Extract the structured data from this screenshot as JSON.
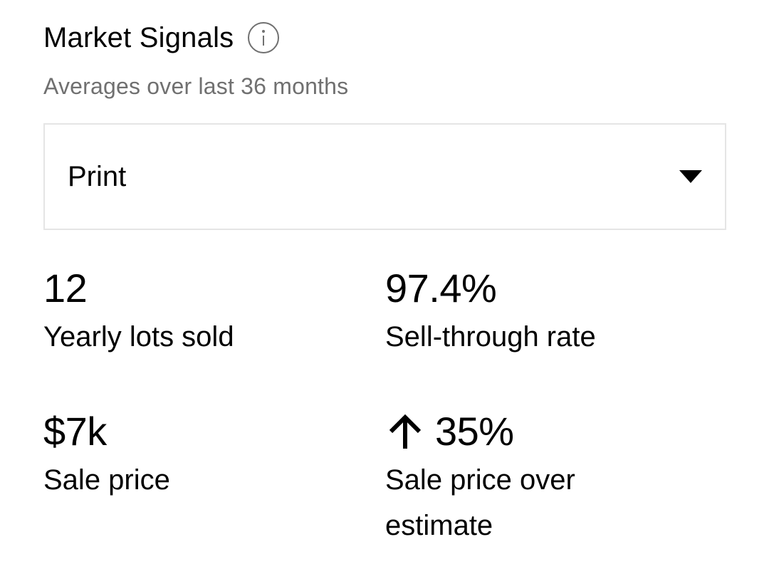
{
  "header": {
    "title": "Market Signals",
    "subtitle": "Averages over last 36 months",
    "info_icon": "info-icon"
  },
  "filter": {
    "selected": "Print",
    "caret_icon": "chevron-down-icon"
  },
  "stats": [
    {
      "value": "12",
      "label": "Yearly lots sold"
    },
    {
      "value": "97.4%",
      "label": "Sell-through rate"
    },
    {
      "value": "$7k",
      "label": "Sale price"
    },
    {
      "value": "35%",
      "label": "Sale price over estimate",
      "trend_icon": "arrow-up-icon"
    }
  ],
  "colors": {
    "text": "#000000",
    "muted": "#707070",
    "border": "#e5e5e5"
  }
}
